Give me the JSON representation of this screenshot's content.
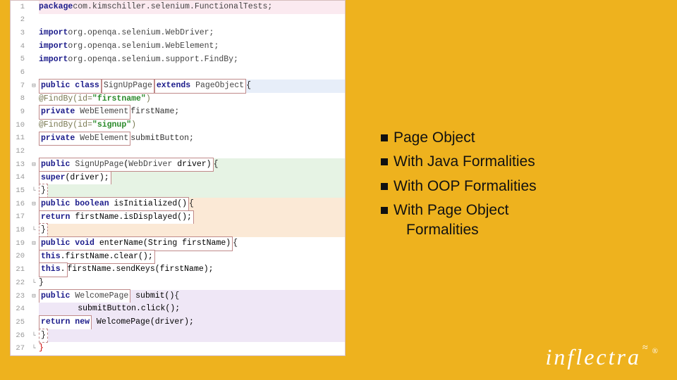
{
  "code": {
    "lines": [
      {
        "n": 1,
        "gut": "",
        "bg": "bg-pink",
        "html": "<span class='kw'>package</span> <span class='pkg'>com.kimschiller.selenium.FunctionalTests;</span>"
      },
      {
        "n": 2,
        "gut": "",
        "bg": "",
        "html": ""
      },
      {
        "n": 3,
        "gut": "",
        "bg": "",
        "html": "<span class='kw'>import</span> <span class='pkg'>org.openqa.selenium.WebDriver;</span>"
      },
      {
        "n": 4,
        "gut": "",
        "bg": "",
        "html": "<span class='kw'>import</span> <span class='pkg'>org.openqa.selenium.WebElement;</span>"
      },
      {
        "n": 5,
        "gut": "",
        "bg": "",
        "html": "<span class='kw'>import</span> <span class='pkg'>org.openqa.selenium.support.FindBy;</span>"
      },
      {
        "n": 6,
        "gut": "",
        "bg": "",
        "html": ""
      },
      {
        "n": 7,
        "gut": "⊟",
        "bg": "bg-blue",
        "html": "<span class='box'><span class='kw'>public class</span></span> <span class='box'><span class='cls'>SignUpPage</span></span> <span class='box'><span class='kw'>extends</span> <span class='cls'>PageObject</span></span> <span class='punct'>{</span>"
      },
      {
        "n": 8,
        "gut": "",
        "bg": "",
        "html": "    <span class='ann'>@FindBy(id=</span><span class='str'>\"firstname\"</span><span class='ann'>)</span>"
      },
      {
        "n": 9,
        "gut": "",
        "bg": "",
        "html": "    <span class='box'><span class='kw'>private</span> <span class='cls'>WebElement</span></span> <span class='id'>firstName;</span>"
      },
      {
        "n": 10,
        "gut": "",
        "bg": "",
        "html": "    <span class='ann'>@FindBy(id=</span><span class='str'>\"signup\"</span><span class='ann'>)</span>"
      },
      {
        "n": 11,
        "gut": "",
        "bg": "",
        "html": "    <span class='box'><span class='kw'>private</span> <span class='cls'>WebElement</span></span> <span class='id'>submitButton;</span>"
      },
      {
        "n": 12,
        "gut": "",
        "bg": "",
        "html": ""
      },
      {
        "n": 13,
        "gut": "⊟",
        "bg": "bg-green",
        "html": "    <span class='box'><span class='kw'>public</span> <span class='cls'>SignUpPage</span>(<span class='cls'>WebDriver</span> driver)</span> <span class='punct'>{</span>"
      },
      {
        "n": 14,
        "gut": "",
        "bg": "bg-green",
        "html": "        <span class='box'><span class='kw'>super</span>(driver);</span>"
      },
      {
        "n": 15,
        "gut": "└",
        "bg": "bg-green",
        "html": "    <span class='box-dash'><span class='punct'>}</span></span>"
      },
      {
        "n": 16,
        "gut": "⊟",
        "bg": "bg-orange",
        "html": "    <span class='box'><span class='kw'>public boolean</span> isInitialized()</span> <span class='punct'>{</span>"
      },
      {
        "n": 17,
        "gut": "",
        "bg": "bg-orange",
        "html": "        <span class='box'><span class='kw'>return</span> firstName.isDisplayed();</span>"
      },
      {
        "n": 18,
        "gut": "└",
        "bg": "bg-orange",
        "html": "    <span class='box-dash'><span class='punct'>}</span></span>"
      },
      {
        "n": 19,
        "gut": "⊟",
        "bg": "",
        "html": "    <span class='box'><span class='kw'>public void</span> enterName(String firstName)</span><span class='punct'>{</span>"
      },
      {
        "n": 20,
        "gut": "",
        "bg": "",
        "html": "        <span class='box'><span class='kw'>this</span>.firstName.clear();</span>"
      },
      {
        "n": 21,
        "gut": "",
        "bg": "",
        "html": "        <span class='box'><span class='kw'>this</span>.</span>firstName.sendKeys(firstName);"
      },
      {
        "n": 22,
        "gut": "└",
        "bg": "",
        "html": "    <span class='punct'>}</span>"
      },
      {
        "n": 23,
        "gut": "⊟",
        "bg": "bg-violet",
        "html": "    <span class='box'><span class='kw'>public</span> <span class='cls'>WelcomePage</span></span> submit()<span class='punct'>{</span>"
      },
      {
        "n": 24,
        "gut": "",
        "bg": "bg-violet",
        "html": "        submitButton.click();"
      },
      {
        "n": 25,
        "gut": "",
        "bg": "bg-violet",
        "html": "        <span class='box'><span class='kw'>return new</span></span> WelcomePage(driver);"
      },
      {
        "n": 26,
        "gut": "└",
        "bg": "bg-violet",
        "html": "    <span class='box-dash'><span class='punct'>}</span></span>"
      },
      {
        "n": 27,
        "gut": "└",
        "bg": "",
        "html": "<span class='punct' style='color:#c00'>}</span>"
      }
    ]
  },
  "bullets": {
    "items": [
      "Page Object",
      "With Java Formalities",
      "With OOP Formalities",
      "With Page Object Formalities"
    ]
  },
  "logo": {
    "text": "inflectra",
    "swoosh": "≈",
    "mark": "®"
  }
}
